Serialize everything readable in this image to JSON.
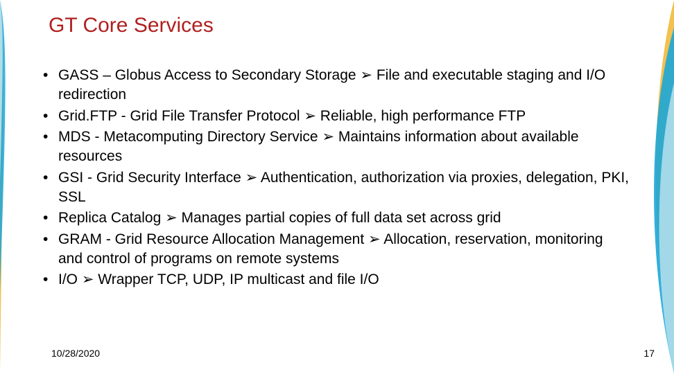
{
  "title": "GT Core Services",
  "bullets": [
    "GASS – Globus Access to Secondary Storage ➢ File and executable staging and I/O redirection",
    "Grid.FTP - Grid File Transfer Protocol ➢ Reliable, high performance FTP",
    "MDS - Metacomputing Directory Service ➢ Maintains information about available resources",
    "GSI - Grid Security Interface ➢ Authentication, authorization via proxies, delegation, PKI, SSL",
    "Replica Catalog ➢ Manages partial copies of full data set across grid",
    "GRAM - Grid Resource Allocation Management ➢ Allocation, reservation, monitoring and control of programs on remote systems",
    "I/O ➢ Wrapper TCP, UDP, IP multicast and file I/O"
  ],
  "footer": {
    "date": "10/28/2020",
    "page": "17"
  }
}
